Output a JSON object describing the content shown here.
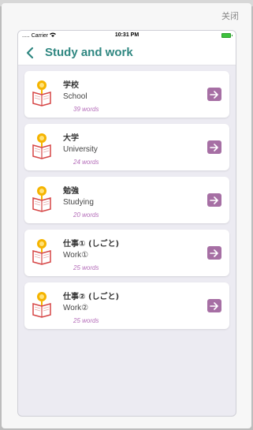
{
  "modal": {
    "close_label": "关闭"
  },
  "status_bar": {
    "carrier": "Carrier",
    "time": "10:31 PM"
  },
  "nav": {
    "title": "Study and work"
  },
  "items": [
    {
      "title": "学校",
      "subtitle": "School",
      "count": "39 words"
    },
    {
      "title": "大学",
      "subtitle": "University",
      "count": "24 words"
    },
    {
      "title": "勉強",
      "subtitle": "Studying",
      "count": "20 words"
    },
    {
      "title": "仕事① (しごと)",
      "subtitle": "Work①",
      "count": "25 words"
    },
    {
      "title": "仕事② (しごと)",
      "subtitle": "Work②",
      "count": "25 words"
    }
  ],
  "colors": {
    "accent": "#2f8781",
    "arrow_bg": "#a66fa4",
    "count_text": "#b36bb8"
  },
  "icons": {
    "item_icon": "book-icon",
    "arrow": "arrow-right-icon",
    "back": "chevron-left-icon"
  }
}
